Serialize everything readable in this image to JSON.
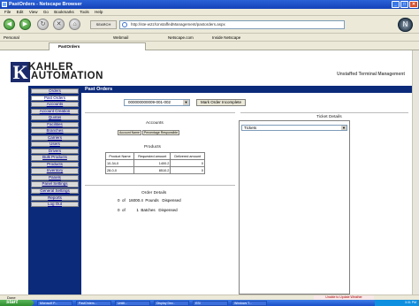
{
  "window": {
    "title": "PastOrders - Netscape Browser"
  },
  "menu": {
    "items": [
      "File",
      "Edit",
      "View",
      "Go",
      "Bookmarks",
      "Tools",
      "Help"
    ]
  },
  "nav": {
    "back": "◀",
    "forward": "▶",
    "reload": "↻",
    "stop": "✕",
    "home": "⌂",
    "search_label": "SEARCH",
    "url": "http://ste-w2z/UnstaffedManagement/pastorders.aspx"
  },
  "personal_bar": {
    "label": "Personal",
    "webmail": "Webmail",
    "netscape": "Netscape.com",
    "inside": "Inside Netscape"
  },
  "tab": {
    "label": "PastOrders"
  },
  "brand": {
    "logo_line1": "KAHLER",
    "logo_line2": "AUTOMATION",
    "tagline": "Unstaffed Terminal Management"
  },
  "sidebar": {
    "items": [
      {
        "label": "Orders"
      },
      {
        "label": "Past Orders",
        "active": true
      },
      {
        "label": "Accounts"
      },
      {
        "label": "Account Creation"
      },
      {
        "label": "Quotas"
      },
      {
        "label": "Facilities"
      },
      {
        "label": "Branches"
      },
      {
        "label": "Carriers"
      },
      {
        "label": "Users"
      },
      {
        "label": "Drivers"
      },
      {
        "label": "Bulk Products"
      },
      {
        "label": "Products"
      },
      {
        "label": "Inventory"
      },
      {
        "label": "Panels"
      },
      {
        "label": "Panel Settings"
      },
      {
        "label": "General Settings"
      },
      {
        "label": "Reports"
      },
      {
        "label": "Log Out"
      }
    ]
  },
  "content": {
    "header": "Past Orders",
    "order_select": "000000000009-001-002",
    "mark_button": "Mark Order Incomplete",
    "accounts": {
      "title": "Accounts",
      "btn_account_name": "Account Name",
      "btn_percentage": "Percentage Responsible"
    },
    "products": {
      "title": "Products",
      "columns": [
        "Product Name",
        "Requested amount",
        "Delivered amount"
      ],
      "rows": [
        [
          "10-34-0",
          "1400.2",
          "0"
        ],
        [
          "28-0-0",
          "8510.2",
          "0"
        ]
      ]
    },
    "order_details": {
      "title": "Order Details",
      "rows": [
        {
          "a": "0",
          "of": "of",
          "total": "16000.4",
          "unit": "Pounds",
          "status": "Dispensed"
        },
        {
          "a": "0",
          "of": "of",
          "total": "1",
          "unit": "Batches",
          "status": "Dispensed"
        }
      ]
    },
    "ticket_details": {
      "title": "Ticket Details",
      "select": "Tickets"
    }
  },
  "status": {
    "text": "Done",
    "popup": "Unable to Update Weather"
  },
  "taskbar": {
    "start": "start",
    "items": [
      "Microsoft P...",
      "PastOrders...",
      "Untitl...",
      "Display Dev...",
      "ESI",
      "Windows T..."
    ],
    "clock": "3:31 PM"
  },
  "colors": {
    "sidebar_bg": "#0c2a7a",
    "header_bg": "#0c2a7a",
    "link": "#00008b"
  }
}
